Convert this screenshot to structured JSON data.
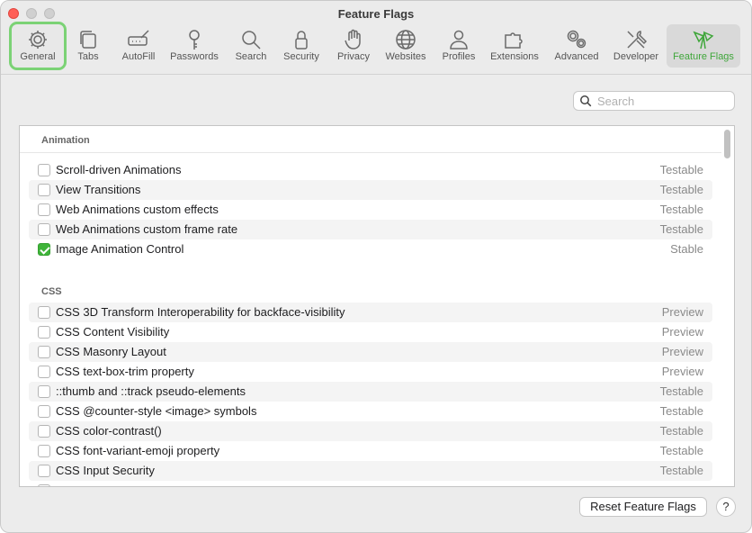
{
  "window": {
    "title": "Feature Flags"
  },
  "toolbar": {
    "items": [
      {
        "label": "General",
        "icon": "gear-icon"
      },
      {
        "label": "Tabs",
        "icon": "tabs-icon"
      },
      {
        "label": "AutoFill",
        "icon": "autofill-icon"
      },
      {
        "label": "Passwords",
        "icon": "key-icon"
      },
      {
        "label": "Search",
        "icon": "search-icon"
      },
      {
        "label": "Security",
        "icon": "lock-icon"
      },
      {
        "label": "Privacy",
        "icon": "hand-icon"
      },
      {
        "label": "Websites",
        "icon": "globe-icon"
      },
      {
        "label": "Profiles",
        "icon": "person-icon"
      },
      {
        "label": "Extensions",
        "icon": "puzzle-icon"
      },
      {
        "label": "Advanced",
        "icon": "gears-icon"
      },
      {
        "label": "Developer",
        "icon": "tools-icon"
      },
      {
        "label": "Feature Flags",
        "icon": "flags-icon"
      }
    ],
    "selected": "Feature Flags",
    "accent_color": "#3fa63a"
  },
  "search": {
    "placeholder": "Search",
    "value": ""
  },
  "sections": [
    {
      "title": "Animation",
      "flags": [
        {
          "name": "Scroll-driven Animations",
          "status": "Testable",
          "checked": false
        },
        {
          "name": "View Transitions",
          "status": "Testable",
          "checked": false
        },
        {
          "name": "Web Animations custom effects",
          "status": "Testable",
          "checked": false
        },
        {
          "name": "Web Animations custom frame rate",
          "status": "Testable",
          "checked": false
        },
        {
          "name": "Image Animation Control",
          "status": "Stable",
          "checked": true
        }
      ]
    },
    {
      "title": "CSS",
      "flags": [
        {
          "name": "CSS 3D Transform Interoperability for backface-visibility",
          "status": "Preview",
          "checked": false
        },
        {
          "name": "CSS Content Visibility",
          "status": "Preview",
          "checked": false
        },
        {
          "name": "CSS Masonry Layout",
          "status": "Preview",
          "checked": false
        },
        {
          "name": "CSS text-box-trim property",
          "status": "Preview",
          "checked": false
        },
        {
          "name": "::thumb and ::track pseudo-elements",
          "status": "Testable",
          "checked": false
        },
        {
          "name": "CSS @counter-style <image> symbols",
          "status": "Testable",
          "checked": false
        },
        {
          "name": "CSS color-contrast()",
          "status": "Testable",
          "checked": false
        },
        {
          "name": "CSS font-variant-emoji property",
          "status": "Testable",
          "checked": false
        },
        {
          "name": "CSS Input Security",
          "status": "Testable",
          "checked": false
        }
      ]
    }
  ],
  "footer": {
    "reset_label": "Reset Feature Flags",
    "help_label": "?"
  }
}
